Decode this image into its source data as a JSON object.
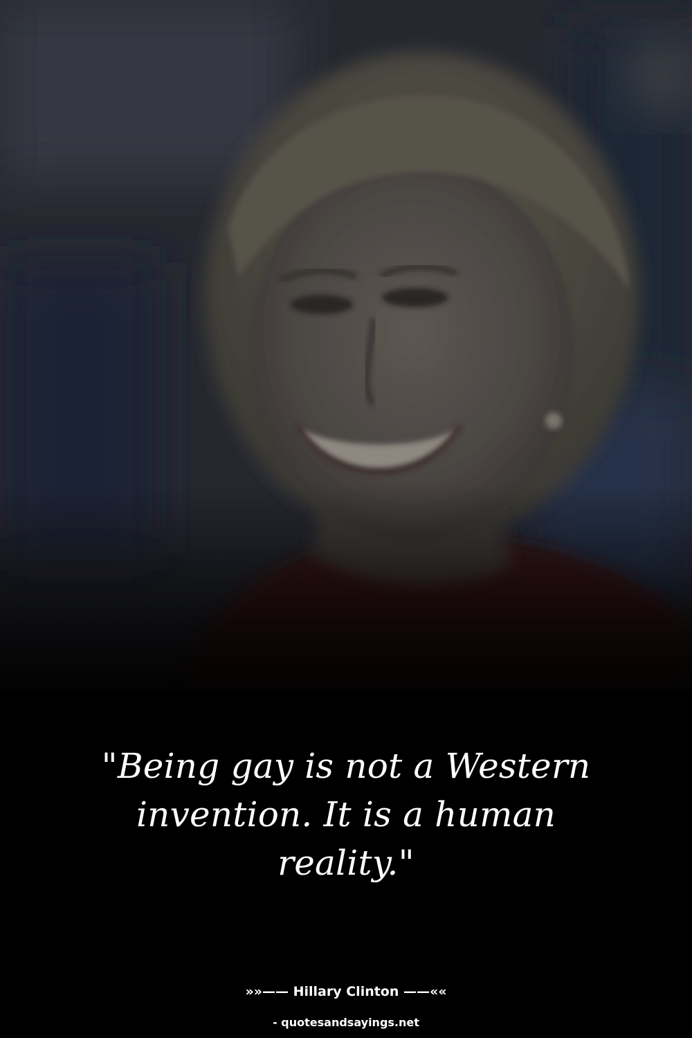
{
  "quote": {
    "text": "\"Being gay is not a Western invention. It is a human reality.\""
  },
  "attribution": {
    "text": "»»—— Hillary Clinton ——««"
  },
  "source": {
    "text": "- quotesandsayings.net"
  },
  "colors": {
    "background": "#000000",
    "text": "#ffffff"
  }
}
